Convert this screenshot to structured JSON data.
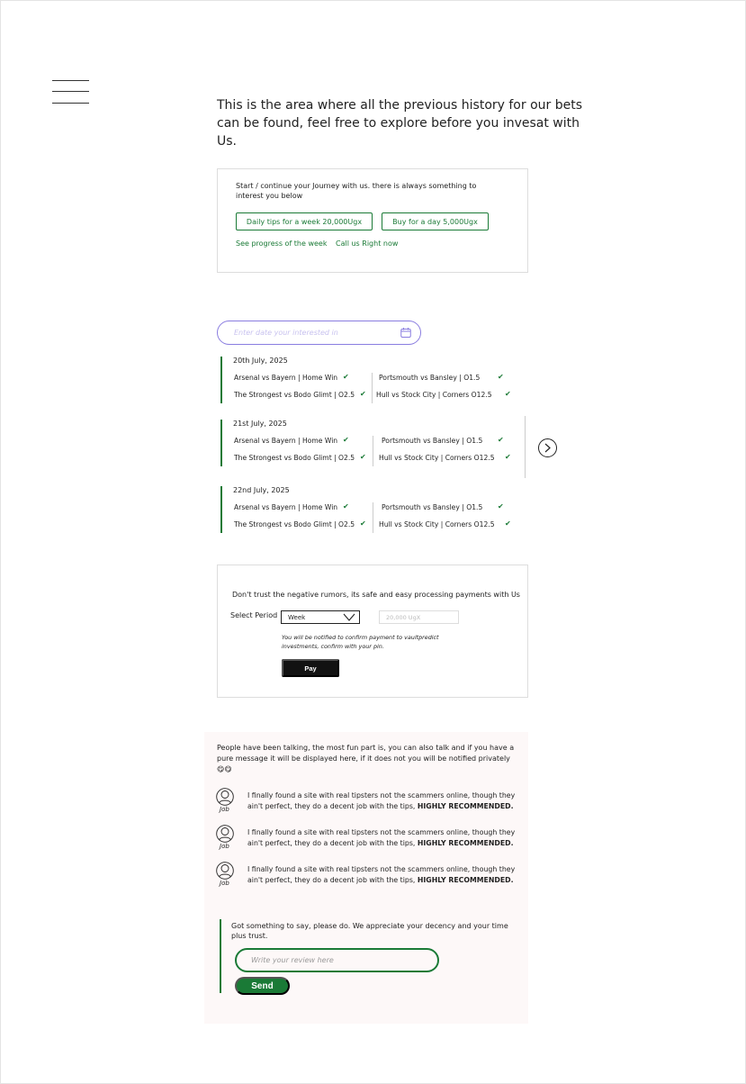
{
  "menu": {
    "icon": "hamburger-icon"
  },
  "intro_text": "This is the area where all the previous history for our bets can be found, feel free to explore before you invesat with Us.",
  "journey": {
    "text": "Start / continue your Journey with us. there is always something to interest you below",
    "buttons": [
      "Daily tips for a week 20,000Ugx",
      "Buy for a day 5,000Ugx"
    ],
    "links": [
      "See progress of the week",
      "Call us Right now"
    ]
  },
  "date_filter": {
    "placeholder": "Enter date your interested in",
    "icon": "calendar-icon"
  },
  "history": [
    {
      "date": "20th July, 2025",
      "bets": [
        "Arsenal vs Bayern | Home Win",
        "Portsmouth vs Bansley | O1.5",
        "The Strongest vs Bodo Glimt | O2.5",
        "Hull vs Stock City | Corners O12.5"
      ]
    },
    {
      "date": "21st July, 2025",
      "bets": [
        "Arsenal vs Bayern | Home Win",
        "Portsmouth vs Bansley | O1.5",
        "The Strongest vs Bodo Glimt | O2.5",
        "Hull vs Stock City | Corners O12.5"
      ]
    },
    {
      "date": "22nd July, 2025",
      "bets": [
        "Arsenal vs Bayern | Home Win",
        "Portsmouth vs Bansley | O1.5",
        "The Strongest vs Bodo Glimt | O2.5",
        "Hull vs Stock City | Corners O12.5"
      ]
    }
  ],
  "check_glyph": "✔",
  "next_icon": "chevron-right-circle-icon",
  "payment": {
    "text": "Don't trust the negative rumors, its safe and easy processing payments with Us",
    "period_label": "Select Period",
    "period_value": "Week",
    "amount_placeholder": "20,000 UgX",
    "notice": "You will be notified to confirm payment to vaultpredict investments, confirm with your pin.",
    "pay_label": "Pay"
  },
  "reviews": {
    "intro": "People have been talking, the most fun part is, you can also talk and if you have a pure message it will be displayed here, if it does not you will be notified privately 😋😋",
    "items": [
      {
        "name": "Job",
        "text": "I finally found a site with real tipsters not the scammers online, though they ain't perfect, they do a decent job with the tips,",
        "emphasis": "HIGHLY RECOMMENDED."
      },
      {
        "name": "Job",
        "text": "I finally found a site with real tipsters not the scammers online, though they ain't perfect, they do a decent job with the tips,",
        "emphasis": "HIGHLY RECOMMENDED."
      },
      {
        "name": "Job",
        "text": "I finally found a site with real tipsters not the scammers online, though they ain't perfect, they do a decent job with the tips,",
        "emphasis": "HIGHLY RECOMMENDED."
      }
    ],
    "write_prompt": "Got something to say, please do. We appreciate your decency and your time plus trust.",
    "input_placeholder": "Write your review here",
    "send_label": "Send"
  },
  "colors": {
    "accent_green": "#1a7a36",
    "date_input_border": "#8a7de0",
    "pay_button": "#121212",
    "reviews_bg": "#fdf8f8"
  }
}
